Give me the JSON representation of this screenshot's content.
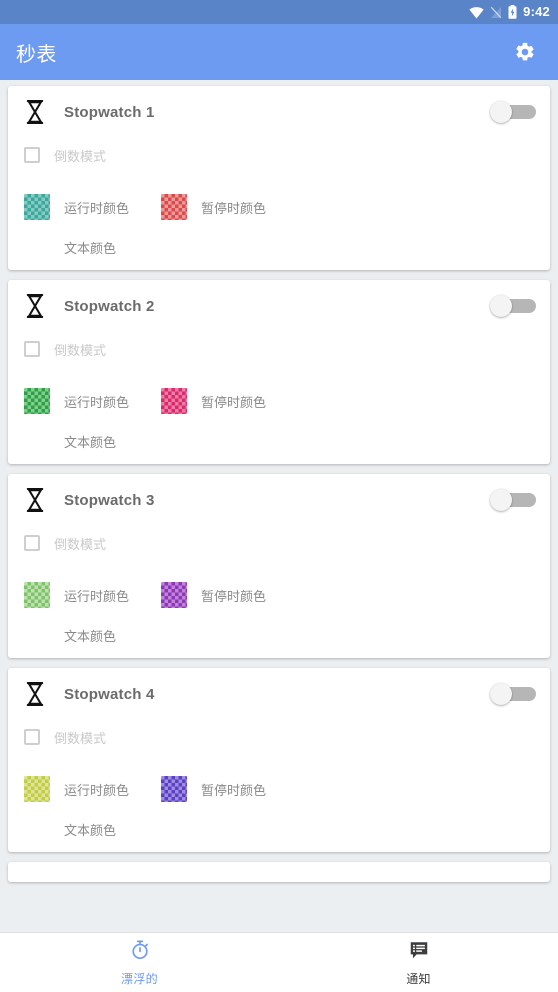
{
  "statusbar": {
    "time": "9:42",
    "icons": [
      "wifi-icon",
      "signal-off-icon",
      "battery-charging-icon"
    ]
  },
  "appbar": {
    "title": "秒表",
    "settings_icon": "gear-icon"
  },
  "colors": {
    "status_bar_bg": "#5a84c8",
    "app_bar_bg": "#6c9bf1",
    "page_bg": "#eceff1",
    "card_bg": "#ffffff",
    "accent": "#6c9bf1",
    "title_text": "#6b6b6b",
    "label_text": "#8a8a8a",
    "disabled_text": "#c9c9c9",
    "switch_track_off": "#b6b6b6",
    "switch_thumb_off": "#f4f4f4"
  },
  "labels": {
    "countdown_mode": "倒数模式",
    "running_color": "运行时颜色",
    "paused_color": "暂停时颜色",
    "text_color": "文本颜色",
    "hourglass_icon": "hourglass-icon"
  },
  "cards": [
    {
      "title": "Stopwatch 1",
      "enabled": false,
      "countdown_checked": false,
      "running_swatch": {
        "a": "#3aa89c",
        "b": "#86cac2"
      },
      "paused_swatch": {
        "a": "#d94b4b",
        "b": "#ef9a9a"
      },
      "text_swatch": {
        "a": "#ffffff",
        "b": "#ffffff"
      }
    },
    {
      "title": "Stopwatch 2",
      "enabled": false,
      "countdown_checked": false,
      "running_swatch": {
        "a": "#2f9e46",
        "b": "#7fd08d"
      },
      "paused_swatch": {
        "a": "#d72b6b",
        "b": "#f07ba6"
      },
      "text_swatch": {
        "a": "#ffffff",
        "b": "#ffffff"
      }
    },
    {
      "title": "Stopwatch 3",
      "enabled": false,
      "countdown_checked": false,
      "running_swatch": {
        "a": "#7cc36a",
        "b": "#bfe0b0"
      },
      "paused_swatch": {
        "a": "#8e35b8",
        "b": "#bf86d8"
      },
      "text_swatch": {
        "a": "#ffffff",
        "b": "#ffffff"
      }
    },
    {
      "title": "Stopwatch 4",
      "enabled": false,
      "countdown_checked": false,
      "running_swatch": {
        "a": "#c2cc45",
        "b": "#dfe49b"
      },
      "paused_swatch": {
        "a": "#5b3fc4",
        "b": "#9e8ee0"
      },
      "text_swatch": {
        "a": "#ffffff",
        "b": "#ffffff"
      }
    },
    {
      "title": "",
      "partial": true,
      "enabled": false,
      "countdown_checked": false,
      "running_swatch": {
        "a": "#ffffff",
        "b": "#ffffff"
      },
      "paused_swatch": {
        "a": "#ffffff",
        "b": "#ffffff"
      },
      "text_swatch": {
        "a": "#ffffff",
        "b": "#ffffff"
      }
    }
  ],
  "bottomnav": {
    "items": [
      {
        "label": "漂浮的",
        "icon": "stopwatch-icon",
        "active": true
      },
      {
        "label": "通知",
        "icon": "notification-message-icon",
        "active": false
      }
    ]
  }
}
